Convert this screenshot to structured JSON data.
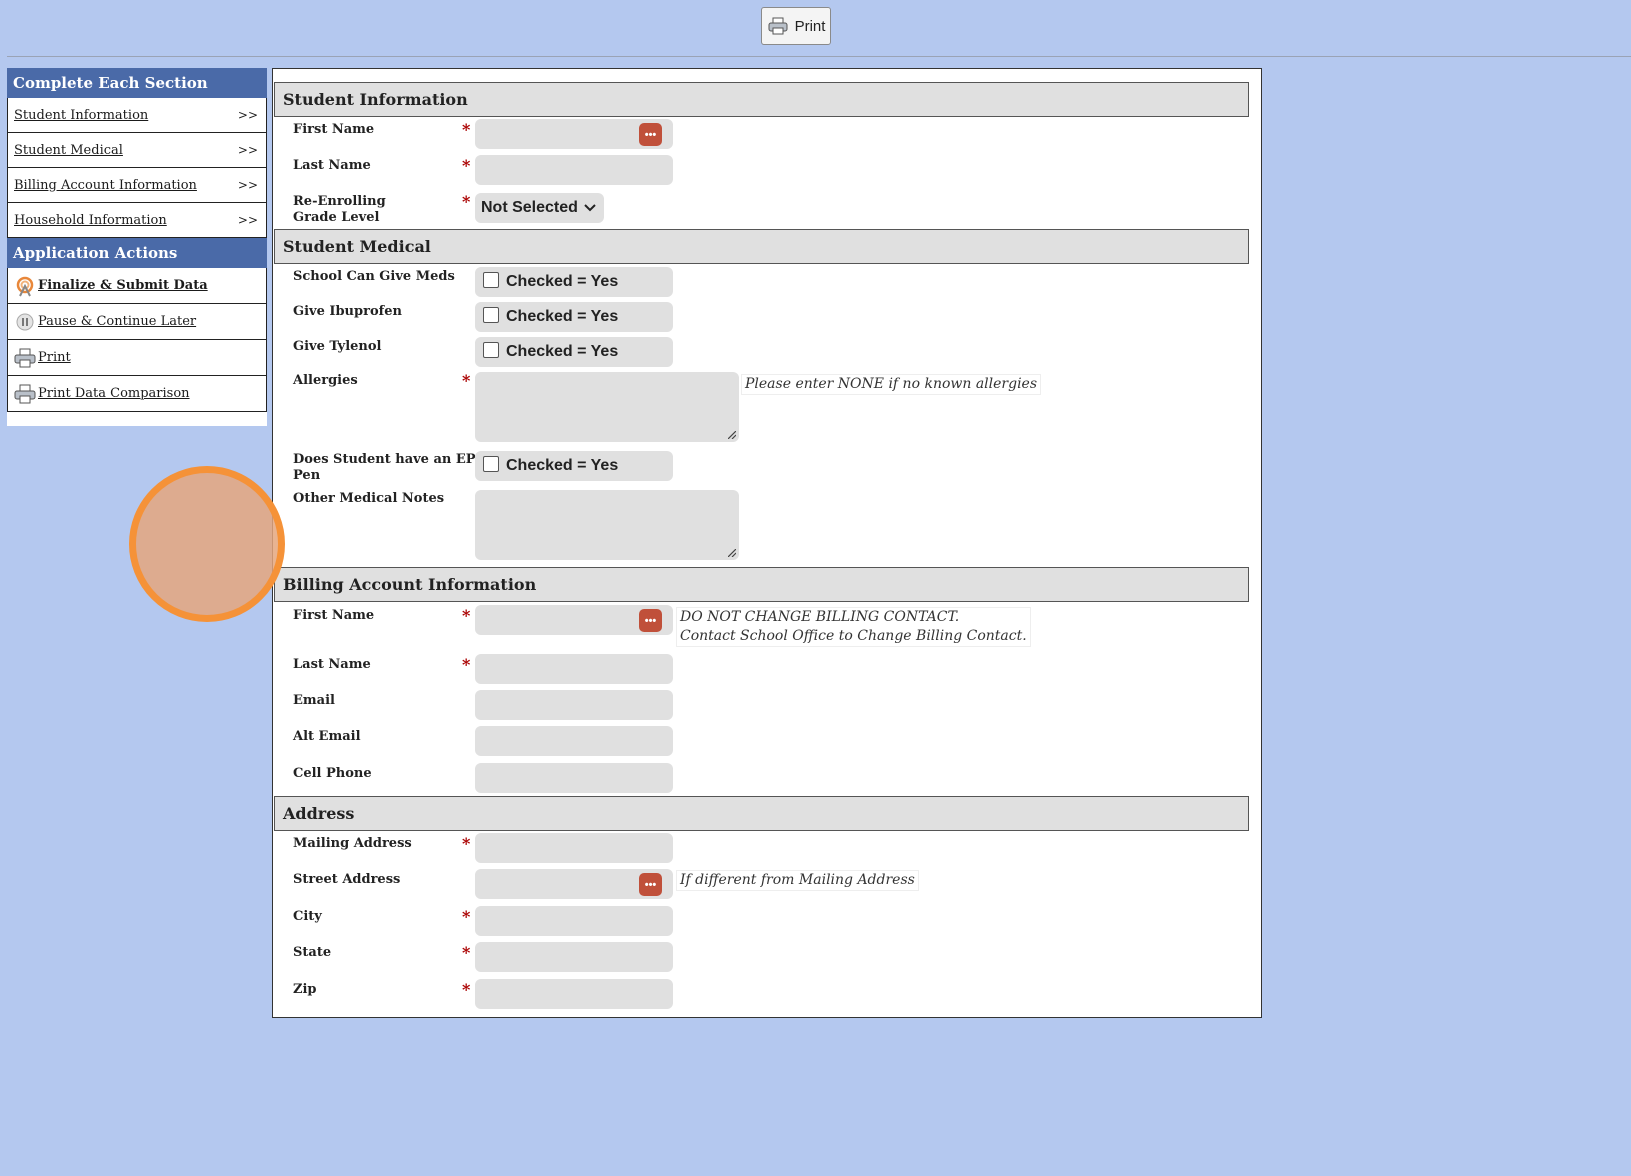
{
  "toolbar": {
    "print_label": "Print",
    "print_icon": "printer-icon"
  },
  "sidebar": {
    "sections_header": "Complete Each Section",
    "sections": [
      {
        "label": "Student Information",
        "arrow": ">>"
      },
      {
        "label": "Student Medical",
        "arrow": ">>"
      },
      {
        "label": "Billing Account Information",
        "arrow": ">>"
      },
      {
        "label": "Household Information",
        "arrow": ">>"
      }
    ],
    "actions_header": "Application Actions",
    "actions": [
      {
        "label": "Finalize & Submit Data",
        "icon": "finalize-icon"
      },
      {
        "label": "Pause & Continue Later",
        "icon": "pause-icon"
      },
      {
        "label": "Print",
        "icon": "printer-icon"
      },
      {
        "label": "Print Data Comparison",
        "icon": "printer-icon"
      }
    ]
  },
  "student_info": {
    "header": "Student Information",
    "first_name": "First Name",
    "last_name": "Last Name",
    "grade_line1": "Re-Enrolling",
    "grade_line2": "Grade Level",
    "grade_value": "Not Selected",
    "required_mark": "*"
  },
  "medical": {
    "header": "Student Medical",
    "meds": "School Can Give Meds",
    "ibuprofen": "Give Ibuprofen",
    "tylenol": "Give Tylenol",
    "allergies": "Allergies",
    "allergies_note": "Please enter NONE if no known allergies",
    "epi_line1": "Does Student have an EPI",
    "epi_line2": "Pen",
    "other_notes": "Other Medical Notes",
    "checkbox_text": "Checked = Yes"
  },
  "billing": {
    "header": "Billing Account Information",
    "first_name": "First Name",
    "note_line1": "DO NOT CHANGE BILLING CONTACT.",
    "note_line2": "Contact School Office to Change Billing Contact.",
    "last_name": "Last Name",
    "email": "Email",
    "alt_email": "Alt Email",
    "cell_phone": "Cell Phone"
  },
  "address": {
    "header": "Address",
    "mailing": "Mailing Address",
    "street": "Street Address",
    "street_note": "If different from Mailing Address",
    "city": "City",
    "state": "State",
    "zip": "Zip"
  }
}
